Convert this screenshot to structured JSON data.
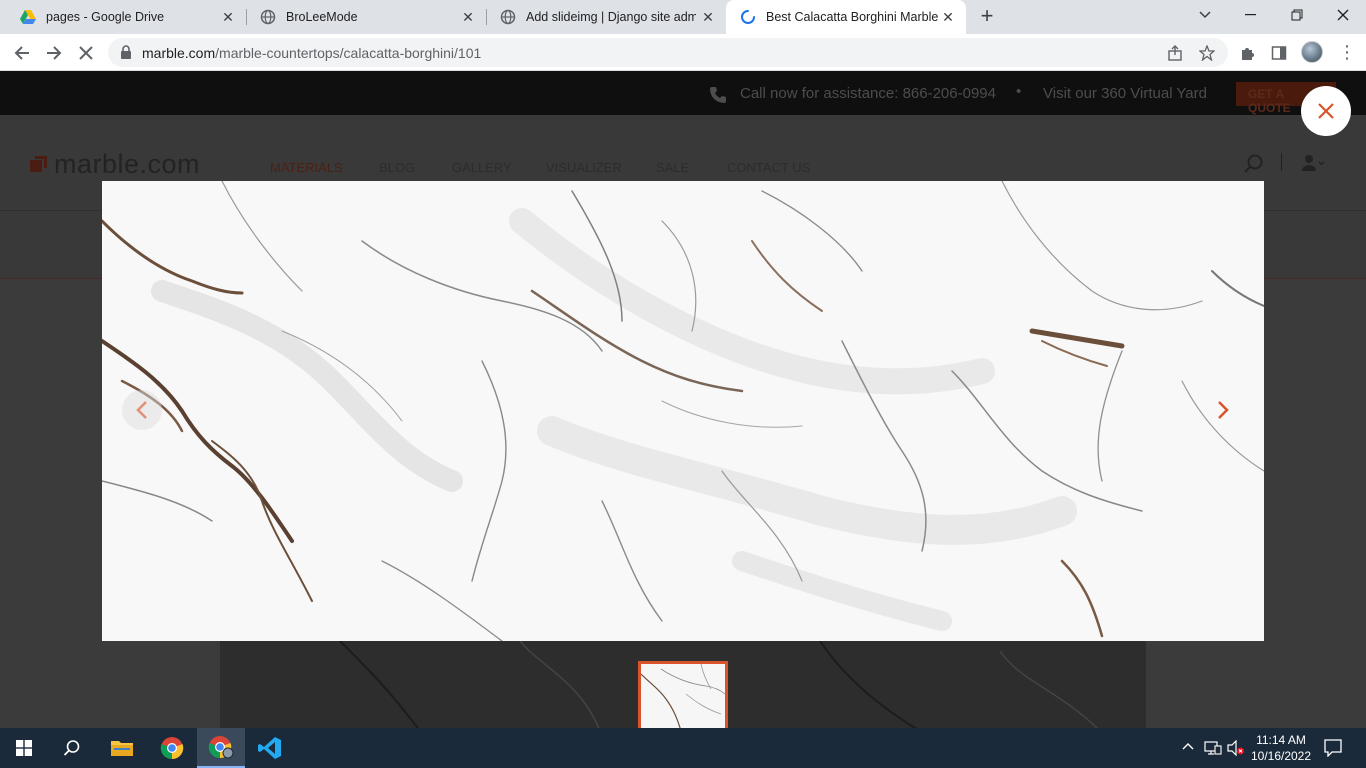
{
  "browser": {
    "tabs": [
      {
        "title": "pages - Google Drive",
        "icon": "google-drive-icon"
      },
      {
        "title": "BroLeeMode",
        "icon": "globe-icon"
      },
      {
        "title": "Add slideimg | Django site admin",
        "icon": "globe-icon"
      },
      {
        "title": "Best Calacatta Borghini Marble (F",
        "icon": "loading-spinner-icon",
        "active": true
      }
    ],
    "url_host": "marble.com",
    "url_path": "/marble-countertops/calacatta-borghini/101"
  },
  "site": {
    "topbar": {
      "call_text": "Call now for assistance: 866-206-0994",
      "separator": "•",
      "visit_text": "Visit our 360 Virtual Yard",
      "quote_button": "GET A QUOTE"
    },
    "logo_text": "marble.com",
    "nav": [
      {
        "label": "MATERIALS",
        "active": true
      },
      {
        "label": "BLOG"
      },
      {
        "label": "GALLERY"
      },
      {
        "label": "VISUALIZER"
      },
      {
        "label": "SALE"
      },
      {
        "label": "CONTACT US"
      }
    ]
  },
  "lightbox": {
    "image_subject": "Calacatta Borghini marble slab",
    "thumbnail_count": 1,
    "selected_thumbnail": 1
  },
  "taskbar": {
    "time": "11:14 AM",
    "date": "10/16/2022"
  },
  "colors": {
    "accent": "#d8542c",
    "taskbar": "#1b2a3a",
    "tabstrip": "#dee1e6"
  }
}
